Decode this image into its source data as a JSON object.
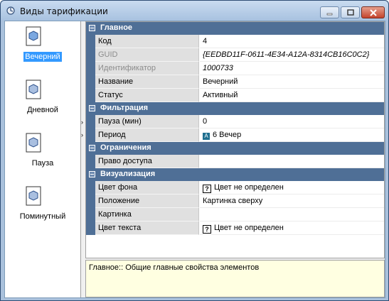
{
  "window": {
    "title": "Виды тарификации",
    "icon": "app-icon",
    "controls": [
      "minimize-icon",
      "maximize-icon",
      "close-icon"
    ]
  },
  "tariffs": [
    {
      "label": "Вечерний",
      "selected": true
    },
    {
      "label": "Дневной",
      "selected": false
    },
    {
      "label": "Пауза",
      "selected": false
    },
    {
      "label": "Поминутный",
      "selected": false
    }
  ],
  "grid": {
    "categories": [
      {
        "label": "Главное",
        "rows": [
          {
            "name": "Код",
            "value": "4",
            "disabled": false
          },
          {
            "name": "GUID",
            "value": "{EEDBD11F-0611-4E34-A12A-8314CB16C0C2}",
            "disabled": true
          },
          {
            "name": "Идентификатор",
            "value": "1000733",
            "disabled": true
          },
          {
            "name": "Название",
            "value": "Вечерний",
            "disabled": false
          },
          {
            "name": "Статус",
            "value": "Активный",
            "disabled": false
          }
        ]
      },
      {
        "label": "Фильтрация",
        "rows": [
          {
            "name": "Пауза (мин)",
            "value": "0",
            "disabled": false
          },
          {
            "name": "Период",
            "value": "6 Вечер",
            "icon_text": "A",
            "disabled": false
          }
        ]
      },
      {
        "label": "Ограничения",
        "rows": [
          {
            "name": "Право доступа",
            "value": "",
            "disabled": false
          }
        ]
      },
      {
        "label": "Визуализация",
        "rows": [
          {
            "name": "Цвет фона",
            "value": "Цвет не определен",
            "qbox": "?",
            "disabled": false
          },
          {
            "name": "Положение",
            "value": "Картинка сверху",
            "disabled": false
          },
          {
            "name": "Картинка",
            "value": "",
            "disabled": false
          },
          {
            "name": "Цвет текста",
            "value": "Цвет не определен",
            "qbox": "?",
            "disabled": false
          }
        ]
      }
    ]
  },
  "description": "Главное:: Общие главные свойства элементов",
  "colors": {
    "category_bg": "#4f6f96",
    "selection": "#3399ff",
    "description_bg": "#ffffe1"
  }
}
